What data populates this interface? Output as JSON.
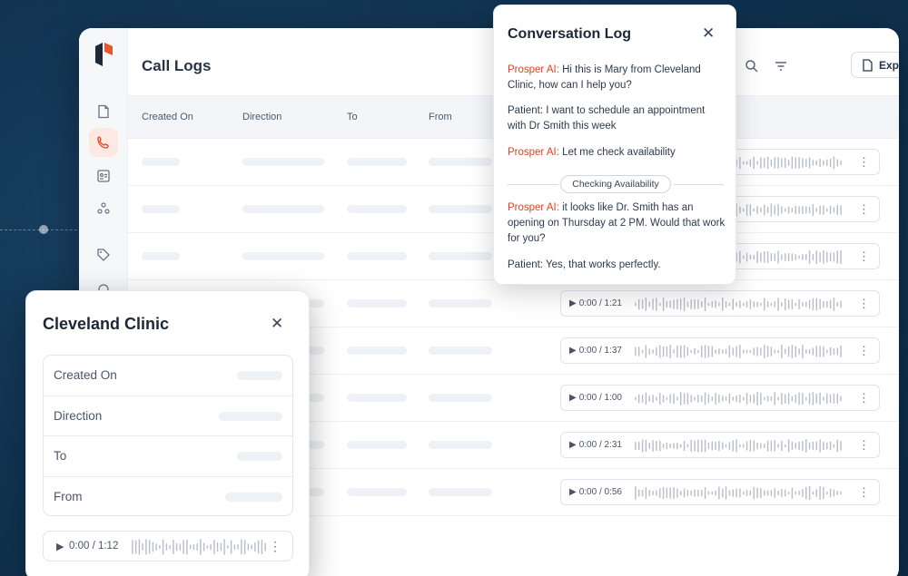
{
  "app": {
    "page_title": "Call Logs",
    "export_label": "Export",
    "columns": [
      "Created On",
      "Direction",
      "To",
      "From"
    ]
  },
  "audio_rows": [
    {
      "time": ""
    },
    {
      "time": ""
    },
    {
      "time": ""
    },
    {
      "time": "0:00 / 1:21"
    },
    {
      "time": "0:00 / 1:37"
    },
    {
      "time": "0:00 / 1:00"
    },
    {
      "time": "0:00 / 2:31"
    },
    {
      "time": "0:00 / 0:56"
    }
  ],
  "conversation": {
    "title": "Conversation Log",
    "messages": [
      {
        "speaker": "Prosper AI:",
        "text": " Hi this is Mary from Cleveland Clinic, how can I help you?"
      },
      {
        "speaker": "Patient:",
        "text": " I want to schedule an appointment with Dr Smith this week"
      },
      {
        "speaker": "Prosper AI:",
        "text": " Let me check availability"
      },
      {
        "speaker": "Prosper AI:",
        "text": " it looks like Dr. Smith has an opening on Thursday at 2 PM. Would that work for you?"
      },
      {
        "speaker": "Patient:",
        "text": " Yes, that works perfectly."
      }
    ],
    "status_pill": "Checking Availability"
  },
  "detail": {
    "title": "Cleveland Clinic",
    "fields": [
      "Created On",
      "Direction",
      "To",
      "From"
    ],
    "audio_time": "0:00 / 1:12"
  },
  "colors": {
    "accent": "#e0421c",
    "background": "#123655"
  }
}
